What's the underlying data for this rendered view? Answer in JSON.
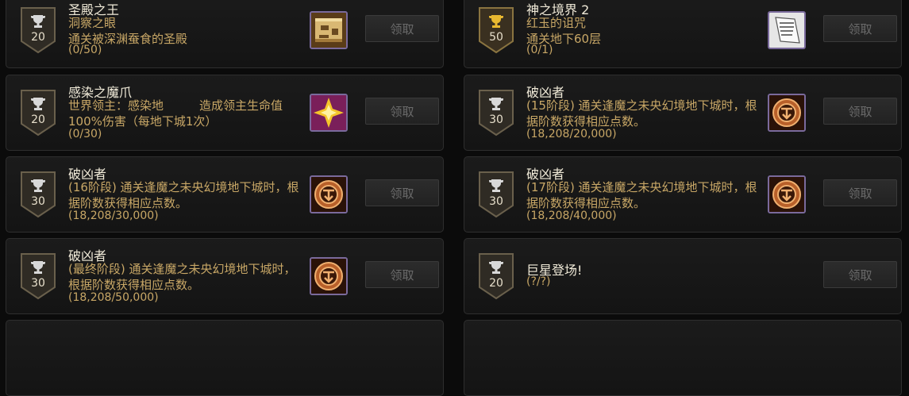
{
  "claim_label": "领取",
  "achievements": [
    {
      "title": "圣殿之王",
      "desc": "洞察之眼\n通关被深渊蚕食的圣殿",
      "progress": "(0/50)",
      "points": "20",
      "badge": "silver",
      "icon": "scroll-map-icon"
    },
    {
      "title": "神之境界 2",
      "desc": "红玉的诅咒\n通关地下60层",
      "progress": "(0/1)",
      "points": "50",
      "badge": "gold",
      "icon": "scroll-paper-icon"
    },
    {
      "title": "感染之魔爪",
      "desc": "世界领主：感染地　　　造成领主生命值100%伤害（每地下城1次）",
      "progress": "(0/30)",
      "points": "20",
      "badge": "silver",
      "icon": "star-burst-icon"
    },
    {
      "title": "破凶者",
      "desc": "(15阶段) 通关逢魔之未央幻境地下城时，根据阶数获得相应点数。",
      "progress": "(18,208/20,000)",
      "points": "30",
      "badge": "silver",
      "icon": "emblem-icon"
    },
    {
      "title": "破凶者",
      "desc": "(16阶段) 通关逢魔之未央幻境地下城时，根据阶数获得相应点数。",
      "progress": "(18,208/30,000)",
      "points": "30",
      "badge": "silver",
      "icon": "emblem-icon"
    },
    {
      "title": "破凶者",
      "desc": "(17阶段) 通关逢魔之未央幻境地下城时，根据阶数获得相应点数。",
      "progress": "(18,208/40,000)",
      "points": "30",
      "badge": "silver",
      "icon": "emblem-icon"
    },
    {
      "title": "破凶者",
      "desc": "(最终阶段) 通关逢魔之未央幻境地下城时，根据阶数获得相应点数。",
      "progress": "(18,208/50,000)",
      "points": "30",
      "badge": "silver",
      "icon": "emblem-icon"
    },
    {
      "title": "巨星登场!",
      "desc": "",
      "progress": "(?/?)",
      "points": "20",
      "badge": "silver",
      "icon": ""
    }
  ]
}
